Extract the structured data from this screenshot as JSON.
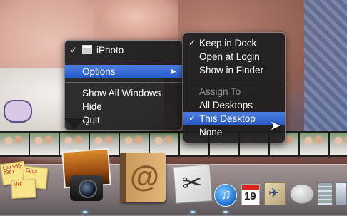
{
  "main_menu": {
    "app_item": {
      "check": "✓",
      "label": "iPhoto"
    },
    "options_label": "Options",
    "options_arrow": "▶",
    "show_all_windows": "Show All Windows",
    "hide": "Hide",
    "quit": "Quit"
  },
  "options_menu": {
    "keep_in_dock": {
      "check": "✓",
      "label": "Keep in Dock"
    },
    "open_at_login": "Open at Login",
    "show_in_finder": "Show in Finder",
    "assign_to": "Assign To",
    "all_desktops": "All Desktops",
    "this_desktop": {
      "check": "✓",
      "label": "This Desktop"
    },
    "none": "None"
  },
  "dock": {
    "stickies_notes": [
      "Lou 555-7361",
      "Eggs",
      "Milk"
    ],
    "ical_day": "19",
    "address_book_glyph": "@",
    "itunes_glyph": "♫",
    "scissors_glyph": "✂",
    "preview_glyph": "✈"
  },
  "colors": {
    "menu_highlight": "#2a5fd0",
    "menu_background": "#1c1c1e",
    "disabled_text": "#8e8e8e"
  }
}
